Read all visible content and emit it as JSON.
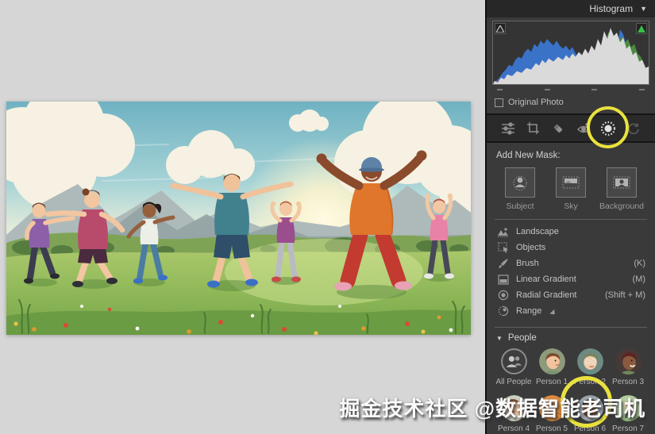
{
  "watermark": {
    "text": "掘金技术社区 @数据智能老司机"
  },
  "colors": {
    "annotation_yellow": "#e9e23e",
    "highlight_clip_green": "#35c043",
    "panel_bg": "#3a3a3a"
  },
  "panel": {
    "header": {
      "title": "Histogram",
      "collapse_glyph": "▼"
    },
    "histogram": {
      "original_photo_label": "Original Photo"
    },
    "toolstrip": [
      {
        "icon": "edit-sliders-icon"
      },
      {
        "icon": "crop-icon"
      },
      {
        "icon": "healing-icon"
      },
      {
        "icon": "red-eye-icon"
      },
      {
        "icon": "masking-icon"
      },
      {
        "icon": "presets-icon"
      }
    ],
    "mask_panel": {
      "add_new_mask_label": "Add New Mask:",
      "quick_masks": [
        {
          "label": "Subject",
          "icon": "subject-mask-icon"
        },
        {
          "label": "Sky",
          "icon": "sky-mask-icon"
        },
        {
          "label": "Background",
          "icon": "background-mask-icon"
        }
      ],
      "mask_tools": [
        {
          "label": "Landscape",
          "shortcut": "",
          "icon": "landscape-icon"
        },
        {
          "label": "Objects",
          "shortcut": "",
          "icon": "objects-icon"
        },
        {
          "label": "Brush",
          "shortcut": "(K)",
          "icon": "brush-icon"
        },
        {
          "label": "Linear Gradient",
          "shortcut": "(M)",
          "icon": "linear-gradient-icon"
        },
        {
          "label": "Radial Gradient",
          "shortcut": "(Shift + M)",
          "icon": "radial-gradient-icon"
        },
        {
          "label": "Range",
          "shortcut": "",
          "icon": "range-icon"
        }
      ],
      "people": {
        "header": "People",
        "collapse_glyph": "▼",
        "row1": [
          {
            "label": "All People"
          },
          {
            "label": "Person 1"
          },
          {
            "label": "Person 2"
          },
          {
            "label": "Person 3"
          }
        ],
        "row2": [
          {
            "label": "Person 4"
          },
          {
            "label": "Person 5"
          },
          {
            "label": "Person 6"
          },
          {
            "label": "Person 7"
          }
        ]
      }
    }
  }
}
